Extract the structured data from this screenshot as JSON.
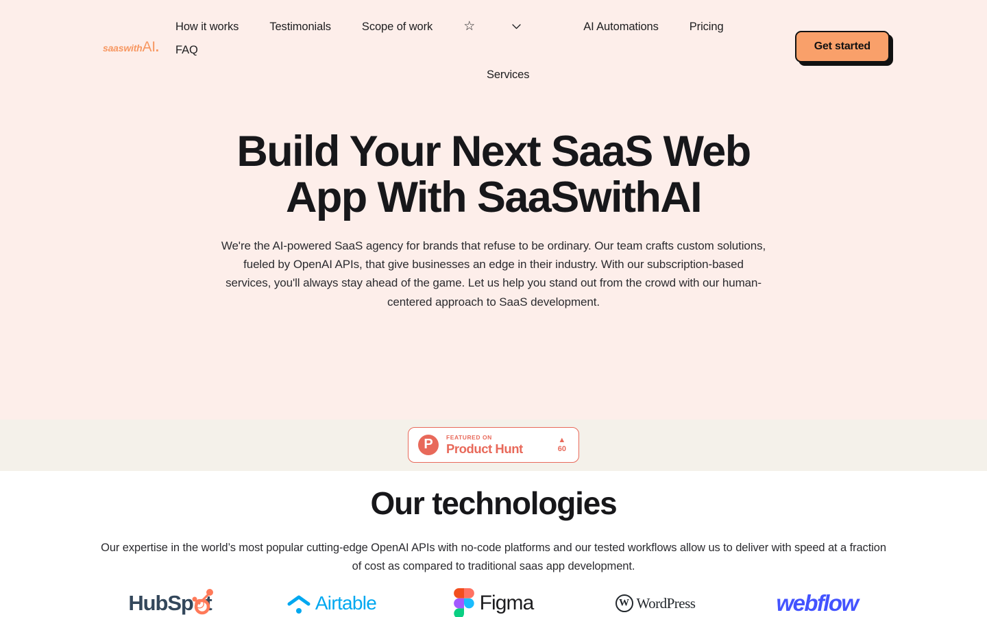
{
  "brand": {
    "logo_italic": "saaswith",
    "logo_ai": "AI",
    "logo_dot": "."
  },
  "nav": {
    "items": [
      {
        "label": "How it works",
        "name": "how-it-works"
      },
      {
        "label": "Testimonials",
        "name": "testimonials"
      },
      {
        "label": "Scope of work",
        "name": "scope-of-work"
      }
    ],
    "dropdown": {
      "label": "Services",
      "star_icon": "☆",
      "chevron_icon": "chevron-down-icon"
    },
    "items_right": [
      {
        "label": "AI Automations",
        "name": "ai-automations"
      },
      {
        "label": "Pricing",
        "name": "pricing"
      },
      {
        "label": "FAQ",
        "name": "faq"
      }
    ],
    "cta_label": "Get started"
  },
  "hero": {
    "title_line1": "Build Your Next SaaS Web",
    "title_line2": "App With SaaSwithAI",
    "subtitle": "We're the AI-powered SaaS agency for brands that refuse to be ordinary. Our team crafts custom solutions, fueled by OpenAI APIs, that give businesses an edge in their industry. With our subscription-based services, you'll always stay ahead of the game. Let us help you stand out from the crowd with our human-centered approach to SaaS development."
  },
  "product_hunt": {
    "logo_letter": "P",
    "featured_label": "FEATURED ON",
    "product_name": "Product Hunt",
    "upvote_icon": "▲",
    "upvote_count": "60"
  },
  "technologies": {
    "title": "Our technologies",
    "description": "Our expertise in the world’s most popular cutting-edge OpenAI APIs with no-code platforms and our tested workflows allow us to deliver with speed at a fraction of cost as compared to traditional saas app development.",
    "logos": [
      {
        "name": "hubspot",
        "label": "HubSp",
        "label_tail": "t"
      },
      {
        "name": "airtable",
        "label": "Airtable"
      },
      {
        "name": "figma",
        "label": "Figma"
      },
      {
        "name": "wordpress",
        "label": "WordPress"
      },
      {
        "name": "webflow",
        "label": "webflow"
      }
    ]
  },
  "colors": {
    "hero_background": "#fdeeea",
    "band_background": "#f4f1ea",
    "accent_orange": "#f9a06a",
    "brand_orange": "#f79761",
    "product_hunt_coral": "#e8695a",
    "text_dark": "#17171a",
    "webflow_blue": "#4353ff",
    "airtable_blue": "#00a8f0",
    "wordpress_dark": "#23282d",
    "hubspot_navy": "#33475b"
  }
}
